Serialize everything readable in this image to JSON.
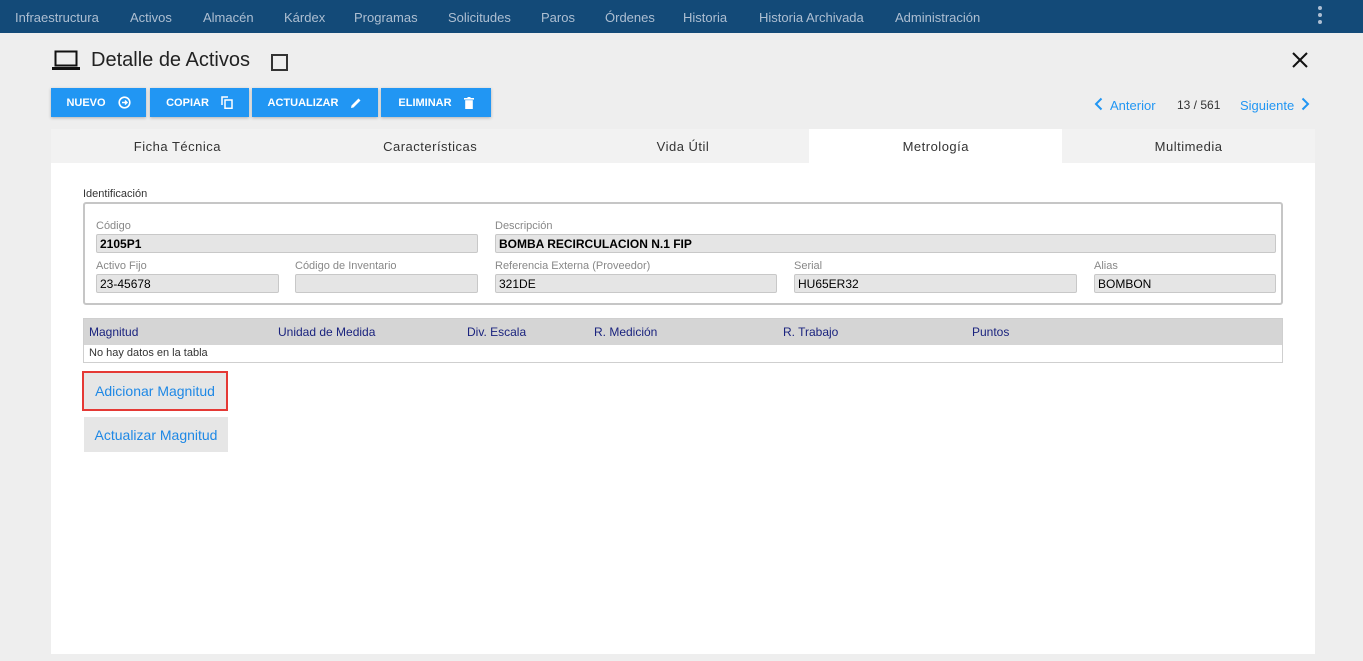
{
  "topnav": {
    "items": [
      "Infraestructura",
      "Activos",
      "Almacén",
      "Kárdex",
      "Programas",
      "Solicitudes",
      "Paros",
      "Órdenes",
      "Historia",
      "Historia Archivada",
      "Administración"
    ]
  },
  "header": {
    "title": "Detalle de Activos"
  },
  "toolbar": {
    "nuevo": "NUEVO",
    "copiar": "COPIAR",
    "actualizar": "ACTUALIZAR",
    "eliminar": "ELIMINAR"
  },
  "pager": {
    "prev": "Anterior",
    "count": "13 / 561",
    "next": "Siguiente"
  },
  "tabs": [
    "Ficha Técnica",
    "Características",
    "Vida Útil",
    "Metrología",
    "Multimedia"
  ],
  "active_tab": "Metrología",
  "identificacion": {
    "legend": "Identificación",
    "codigo": {
      "label": "Código",
      "value": "2105P1"
    },
    "descripcion": {
      "label": "Descripción",
      "value": "BOMBA RECIRCULACION N.1 FIP"
    },
    "activo_fijo": {
      "label": "Activo Fijo",
      "value": "23-45678"
    },
    "codigo_inventario": {
      "label": "Código de Inventario",
      "value": ""
    },
    "referencia_externa": {
      "label": "Referencia Externa (Proveedor)",
      "value": "321DE"
    },
    "serial": {
      "label": "Serial",
      "value": "HU65ER32"
    },
    "alias": {
      "label": "Alias",
      "value": "BOMBON"
    }
  },
  "table": {
    "columns": [
      "Magnitud",
      "Unidad de Medida",
      "Div. Escala",
      "R. Medición",
      "R. Trabajo",
      "Puntos"
    ],
    "empty_text": "No hay datos en la tabla"
  },
  "actions": {
    "adicionar": "Adicionar Magnitud",
    "actualizar": "Actualizar Magnitud"
  },
  "colors": {
    "topnav_bg": "#134a78",
    "accent": "#2196f3",
    "table_header_text": "#1a237e",
    "highlight_outline": "#e53935"
  }
}
